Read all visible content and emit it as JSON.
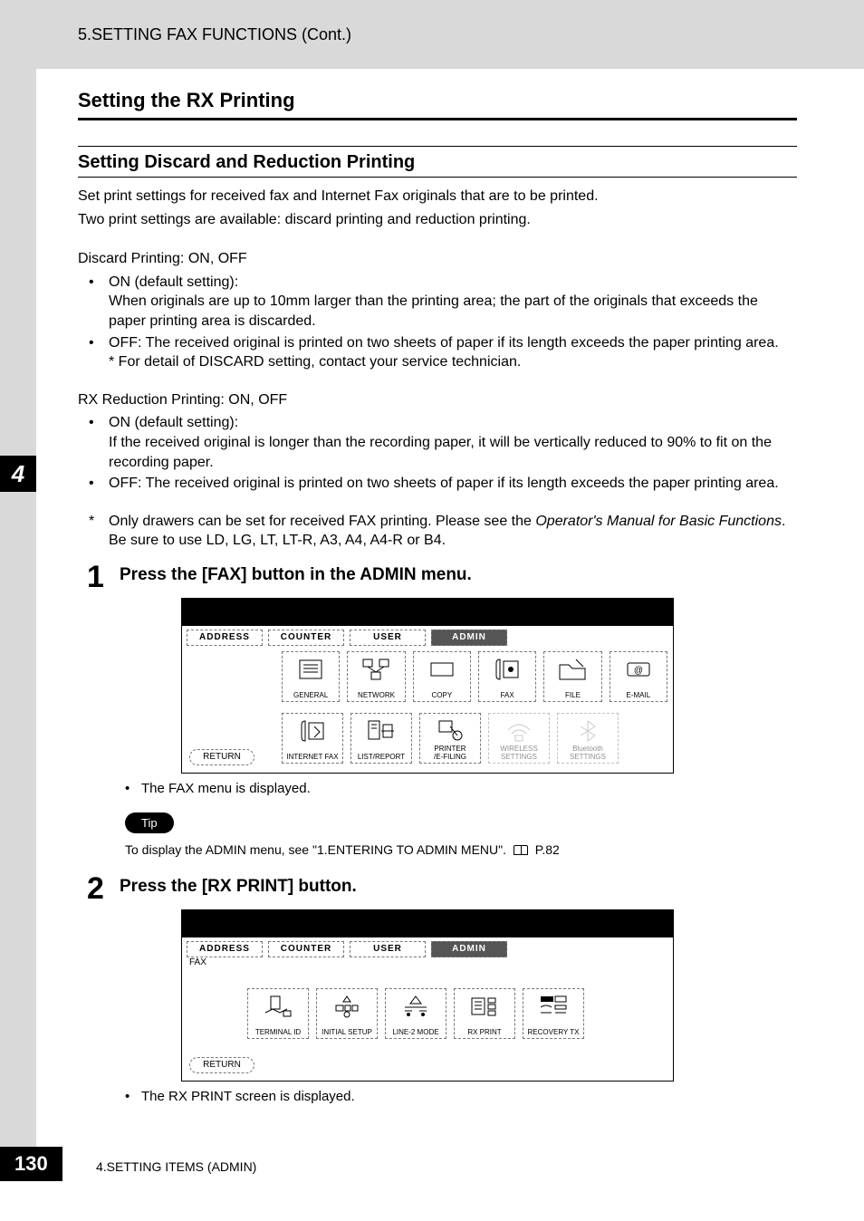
{
  "header": {
    "breadcrumb": "5.SETTING FAX FUNCTIONS (Cont.)"
  },
  "section": {
    "h1": "Setting the RX Printing",
    "h2": "Setting Discard and Reduction Printing",
    "intro1": "Set print settings for received fax and Internet Fax originals that are to be printed.",
    "intro2": "Two print settings are available: discard printing and reduction printing.",
    "discard_title": "Discard Printing: ON, OFF",
    "discard_on_label": "ON (default setting):",
    "discard_on_text": "When originals are up to 10mm larger than the printing area; the part of the originals that exceeds the paper printing area is discarded.",
    "discard_off_text": "OFF: The received original is printed on two sheets of paper if its length exceeds the paper printing area.",
    "discard_note": "* For detail of DISCARD setting, contact your service technician.",
    "rx_title": "RX Reduction Printing: ON, OFF",
    "rx_on_label": "ON (default setting):",
    "rx_on_text": "If the received original is longer than the recording paper, it will be vertically reduced to 90% to fit on the recording paper.",
    "rx_off_text": "OFF: The received original is printed on two sheets of paper if its length exceeds the paper printing area.",
    "star_note_a": "Only drawers can be set for received FAX printing.   Please see the ",
    "star_note_italic": "Operator's Manual for Basic Functions",
    "star_note_b": ". Be sure to use LD, LG, LT, LT-R, A3, A4, A4-R or B4."
  },
  "steps": {
    "s1": {
      "num": "1",
      "title": "Press the [FAX] button in the ADMIN menu.",
      "sub": "The FAX menu is displayed."
    },
    "s2": {
      "num": "2",
      "title": "Press the [RX PRINT] button.",
      "sub": "The RX PRINT screen is displayed."
    }
  },
  "tip": {
    "label": "Tip",
    "text_a": "To display the ADMIN menu, see \"1.ENTERING TO ADMIN MENU\".",
    "text_b": "P.82"
  },
  "screen1": {
    "tabs": [
      "ADDRESS",
      "COUNTER",
      "USER",
      "ADMIN"
    ],
    "row1": [
      "GENERAL",
      "NETWORK",
      "COPY",
      "FAX",
      "FILE",
      "E-MAIL"
    ],
    "row2": [
      "INTERNET FAX",
      "LIST/REPORT",
      "PRINTER\n/E-FILING",
      "WIRELESS\nSETTINGS",
      "Bluetooth\nSETTINGS"
    ],
    "return": "RETURN"
  },
  "screen2": {
    "tabs": [
      "ADDRESS",
      "COUNTER",
      "USER",
      "ADMIN"
    ],
    "faxlabel": "FAX",
    "row": [
      "TERMINAL ID",
      "INITIAL SETUP",
      "LINE-2 MODE",
      "RX PRINT",
      "RECOVERY TX"
    ],
    "return": "RETURN"
  },
  "chapter_tab": "4",
  "footer": {
    "page": "130",
    "text": "4.SETTING ITEMS (ADMIN)"
  }
}
